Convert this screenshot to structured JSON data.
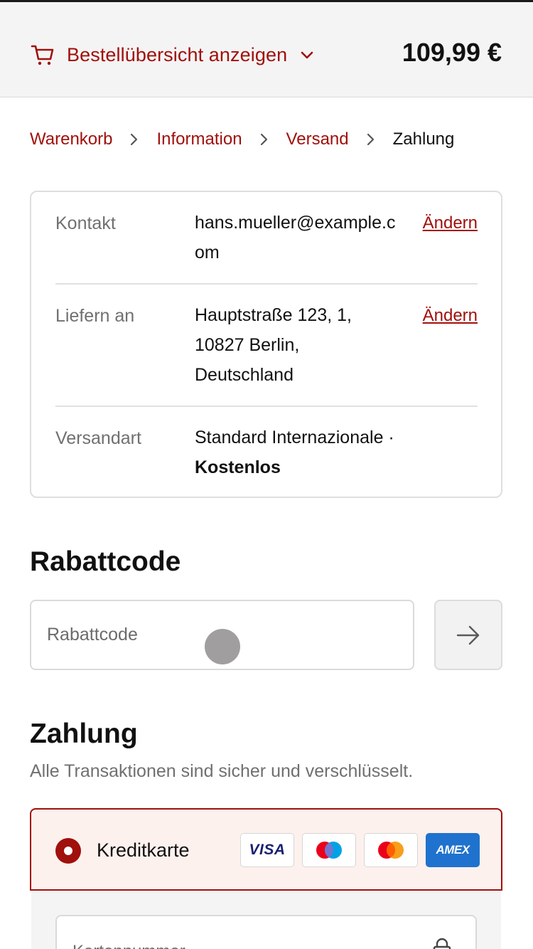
{
  "colors": {
    "accent": "#a0100c",
    "selected_bg": "#fdf1ee",
    "muted_text": "#707070"
  },
  "summary": {
    "toggle_label": "Bestellübersicht anzeigen",
    "total": "109,99 €"
  },
  "breadcrumb": {
    "items": [
      {
        "label": "Warenkorb",
        "current": false
      },
      {
        "label": "Information",
        "current": false
      },
      {
        "label": "Versand",
        "current": false
      },
      {
        "label": "Zahlung",
        "current": true
      }
    ]
  },
  "review": {
    "contact": {
      "label": "Kontakt",
      "value": "hans.mueller@example.com",
      "change": "Ändern"
    },
    "ship_to": {
      "label": "Liefern an",
      "value": "Hauptstraße 123, 1, 10827 Berlin, Deutschland",
      "change": "Ändern"
    },
    "method": {
      "label": "Versandart",
      "value": "Standard Internazionale · ",
      "value_bold": "Kostenlos"
    }
  },
  "discount": {
    "title": "Rabattcode",
    "placeholder": "Rabattcode",
    "apply_icon": "arrow-right-icon"
  },
  "payment": {
    "title": "Zahlung",
    "subtitle": "Alle Transaktionen sind sicher und verschlüsselt.",
    "selected_option": "Kreditkarte",
    "card_logos": [
      "VISA",
      "Maestro",
      "Mastercard",
      "AMEX"
    ],
    "amex_label": "AMEX",
    "visa_label": "VISA",
    "card_number_placeholder": "Kartennummer"
  }
}
